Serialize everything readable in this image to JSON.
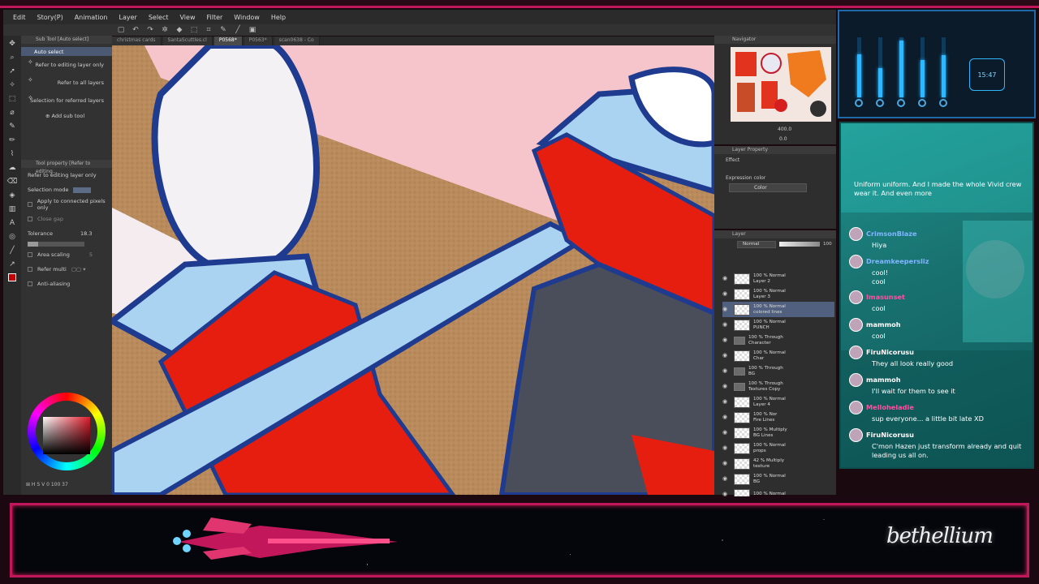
{
  "app": {
    "menu": [
      "Edit",
      "Story(P)",
      "Animation",
      "Layer",
      "Select",
      "View",
      "Filter",
      "Window",
      "Help"
    ]
  },
  "tabs": [
    "christmas cards",
    "SantaScuttles.cl",
    "P0568*",
    "P0563*",
    "scan0638 - Co"
  ],
  "subtool": {
    "header": "Sub Tool [Auto select]",
    "items": [
      "Auto select",
      "Refer to editing layer only",
      "Refer to all layers",
      "Selection for referred layers"
    ],
    "add_label": "Add sub tool",
    "prop_header": "Tool property [Refer to editing...",
    "prop_title": "Refer to editing layer only",
    "selection_mode": "Selection mode",
    "apply_connected": "Apply to connected pixels only",
    "close_gap": "Close gap",
    "tolerance_label": "Tolerance",
    "tolerance_value": "18.3",
    "tolerance_fraction": 0.18,
    "area_scaling": "Area scaling",
    "area_scaling_value": "5",
    "refer_multi": "Refer multi",
    "anti_aliasing": "Anti-aliasing",
    "color_values": "0  100  37"
  },
  "navigator": {
    "header": "Navigator",
    "zoom": "400.0",
    "rotation": "0.0"
  },
  "layer_property": {
    "header": "Layer Property",
    "effect": "Effect",
    "expression_color": "Expression color",
    "color_option": "Color"
  },
  "layers": {
    "header": "Layer",
    "blend": "Normal",
    "opacity": "100",
    "items": [
      {
        "label": "Layer 2",
        "pct": "100 %",
        "mode": "Normal",
        "type": "raster",
        "selected": false
      },
      {
        "label": "Layer 3",
        "pct": "100 %",
        "mode": "Normal",
        "type": "raster",
        "selected": false
      },
      {
        "label": "colored lines",
        "pct": "100 %",
        "mode": "Normal",
        "type": "raster",
        "selected": true
      },
      {
        "label": "PUNCH",
        "pct": "100 %",
        "mode": "Normal",
        "type": "raster",
        "selected": false
      },
      {
        "label": "Character",
        "pct": "100 %",
        "mode": "Through",
        "type": "folder",
        "selected": false
      },
      {
        "label": "Char",
        "pct": "100 %",
        "mode": "Normal",
        "type": "raster",
        "selected": false
      },
      {
        "label": "BG",
        "pct": "100 %",
        "mode": "Through",
        "type": "folder",
        "selected": false
      },
      {
        "label": "Textures Copy",
        "pct": "100 %",
        "mode": "Through",
        "type": "folder",
        "selected": false
      },
      {
        "label": "Layer 4",
        "pct": "100 %",
        "mode": "Normal",
        "type": "raster",
        "selected": false
      },
      {
        "label": "Fire Lines",
        "pct": "100 %",
        "mode": "Nor",
        "type": "raster",
        "selected": false
      },
      {
        "label": "BG Lines",
        "pct": "100 %",
        "mode": "Multiply",
        "type": "raster",
        "selected": false
      },
      {
        "label": "props",
        "pct": "100 %",
        "mode": "Normal",
        "type": "raster",
        "selected": false
      },
      {
        "label": "texture",
        "pct": "42 %",
        "mode": "Multiply",
        "type": "raster",
        "selected": false
      },
      {
        "label": "BG",
        "pct": "100 %",
        "mode": "Normal",
        "type": "raster",
        "selected": false
      },
      {
        "label": "",
        "pct": "100 %",
        "mode": "Normal",
        "type": "raster",
        "selected": false
      }
    ]
  },
  "deck": {
    "clock": "15:47",
    "faders": [
      0.72,
      0.48,
      0.95,
      0.62,
      0.7
    ]
  },
  "chat": {
    "first_text": "Uniform uniform. And I made the whole Vivid crew wear it. And even more",
    "messages": [
      {
        "user": "CrimsonBlaze",
        "text": "Hiya",
        "color": "#7fb6ff"
      },
      {
        "user": "Dreamkeepersliz",
        "text": "cool!\ncool",
        "color": "#7fb6ff"
      },
      {
        "user": "Imasunset",
        "text": "cool",
        "color": "#ff4fa3"
      },
      {
        "user": "mammoh",
        "text": "cool",
        "color": "#ffffff"
      },
      {
        "user": "FiruNicorusu",
        "text": "They all look really good",
        "color": "#ffffff"
      },
      {
        "user": "mammoh",
        "text": "I'll wait for them to see it",
        "color": "#ffffff"
      },
      {
        "user": "Melloheladie",
        "text": "sup everyone... a little bit late XD",
        "color": "#ff4fa3"
      },
      {
        "user": "FiruNicorusu",
        "text": "C'mon Hazen just transform already and quit leading us all on.",
        "color": "#ffffff"
      }
    ]
  },
  "brand": {
    "logo": "bethellium",
    "accent": "#d81e5b"
  },
  "icons": [
    "move-icon",
    "zoom-icon",
    "auto-select-icon",
    "pen-icon",
    "eraser-icon",
    "fill-icon",
    "text-icon",
    "eye-icon",
    "folder-icon",
    "gear-icon"
  ]
}
